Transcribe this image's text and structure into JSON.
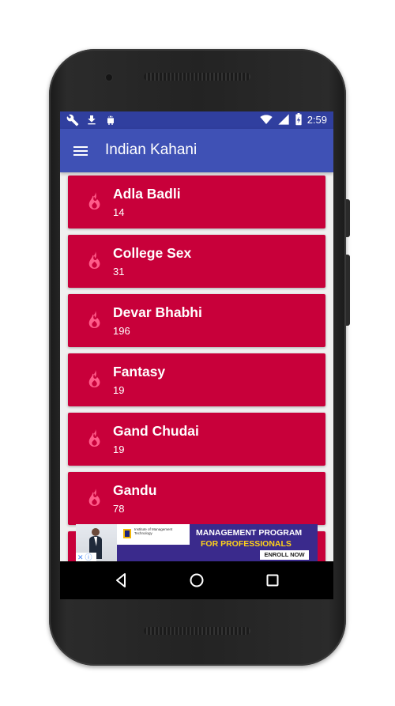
{
  "status_bar": {
    "time": "2:59",
    "left_icons": [
      "wrench-icon",
      "download-icon",
      "android-icon"
    ],
    "right_icons": [
      "wifi-icon",
      "signal-icon",
      "battery-charging-icon"
    ]
  },
  "app_bar": {
    "title": "Indian Kahani",
    "menu_icon": "hamburger-menu-icon"
  },
  "categories": [
    {
      "title": "Adla Badli",
      "count": "14"
    },
    {
      "title": "College Sex",
      "count": "31"
    },
    {
      "title": "Devar Bhabhi",
      "count": "196"
    },
    {
      "title": "Fantasy",
      "count": "19"
    },
    {
      "title": "Gand Chudai",
      "count": "19"
    },
    {
      "title": "Gandu",
      "count": "78"
    }
  ],
  "ad": {
    "logo_text": "Institute of Management Technology",
    "headline_1": "MANAGEMENT PROGRAM",
    "headline_2": "FOR PROFESSIONALS",
    "cta": "ENROLL NOW"
  },
  "nav_bar": {
    "buttons": [
      "back-icon",
      "home-icon",
      "recents-icon"
    ]
  },
  "colors": {
    "status_bar": "#303f9f",
    "app_bar": "#3f51b5",
    "card": "#c8003a",
    "card_icon": "#ff5c8a",
    "ad_background": "#3a2a8c",
    "ad_headline_2": "#ffd21a"
  }
}
